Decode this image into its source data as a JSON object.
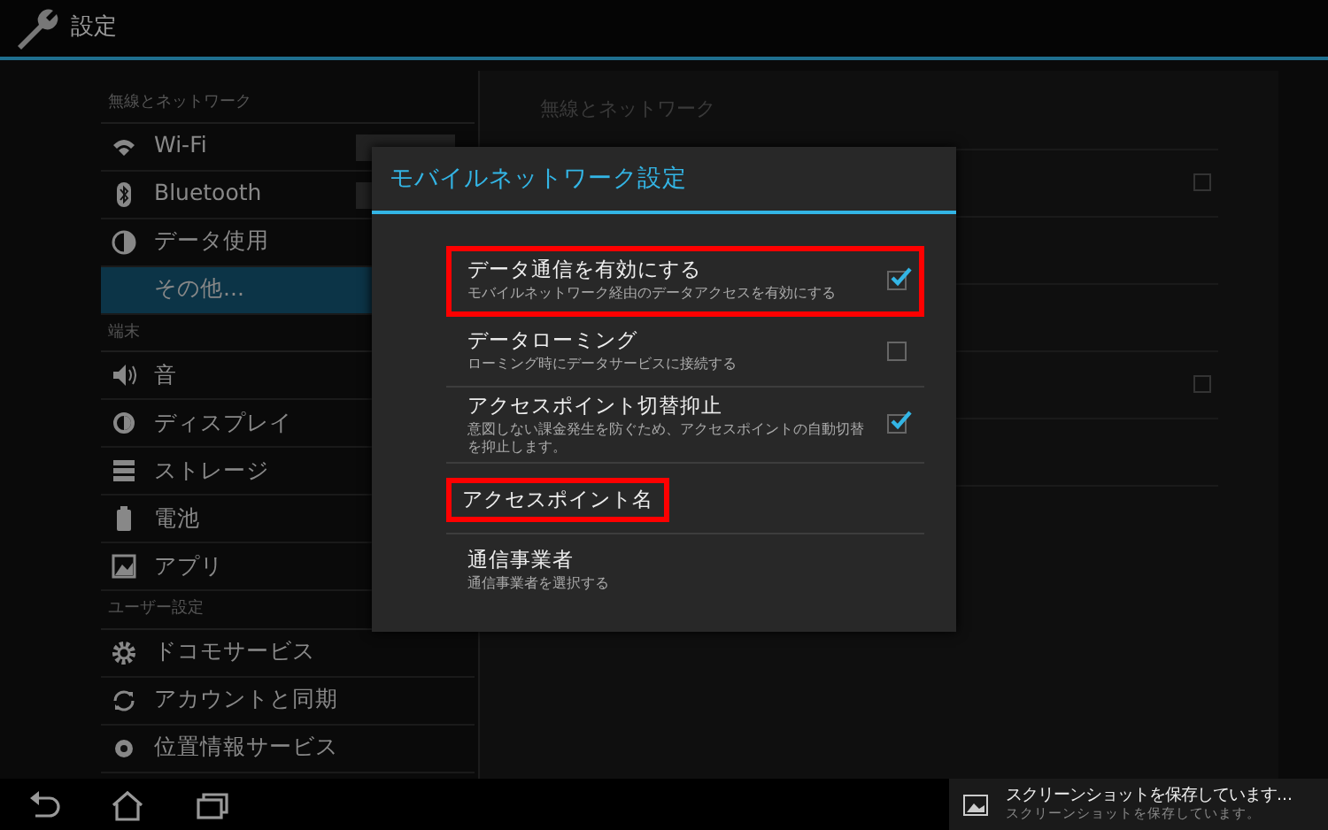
{
  "action_bar": {
    "title": "設定"
  },
  "sidebar": {
    "sections": [
      {
        "header": "無線とネットワーク",
        "items": [
          {
            "label": "Wi-Fi",
            "selected": false,
            "toggle": true
          },
          {
            "label": "Bluetooth",
            "selected": false,
            "toggle": true
          },
          {
            "label": "データ使用",
            "selected": false,
            "toggle": false
          },
          {
            "label": "その他...",
            "selected": true,
            "toggle": false
          }
        ]
      },
      {
        "header": "端末",
        "items": [
          {
            "label": "音",
            "selected": false,
            "toggle": false
          },
          {
            "label": "ディスプレイ",
            "selected": false,
            "toggle": false
          },
          {
            "label": "ストレージ",
            "selected": false,
            "toggle": false
          },
          {
            "label": "電池",
            "selected": false,
            "toggle": false
          },
          {
            "label": "アプリ",
            "selected": false,
            "toggle": false
          }
        ]
      },
      {
        "header": "ユーザー設定",
        "items": [
          {
            "label": "ドコモサービス",
            "selected": false,
            "toggle": false
          },
          {
            "label": "アカウントと同期",
            "selected": false,
            "toggle": false
          },
          {
            "label": "位置情報サービス",
            "selected": false,
            "toggle": false
          }
        ]
      }
    ]
  },
  "detail_pane": {
    "header": "無線とネットワーク",
    "rows": [
      {
        "kind": "checkbox",
        "checked": false
      },
      {
        "kind": "blank"
      },
      {
        "kind": "blank"
      },
      {
        "kind": "checkbox",
        "checked": false
      },
      {
        "kind": "blank"
      }
    ]
  },
  "dialog": {
    "title": "モバイルネットワーク設定",
    "items": [
      {
        "kind": "checkbox",
        "title": "データ通信を有効にする",
        "summary": "モバイルネットワーク経由のデータアクセスを有効にする",
        "checked": true,
        "highlighted": true
      },
      {
        "kind": "checkbox",
        "title": "データローミング",
        "summary": "ローミング時にデータサービスに接続する",
        "checked": false,
        "highlighted": false
      },
      {
        "kind": "checkbox",
        "title": "アクセスポイント切替抑止",
        "summary": "意図しない課金発生を防ぐため、アクセスポイントの自動切替を抑止します。",
        "checked": true,
        "highlighted": false
      },
      {
        "kind": "link",
        "title": "アクセスポイント名",
        "highlighted": true
      },
      {
        "kind": "link",
        "title": "通信事業者",
        "summary": "通信事業者を選択する",
        "highlighted": false
      }
    ]
  },
  "notification": {
    "title": "スクリーンショットを保存しています...",
    "text": "スクリーンショットを保存しています。"
  }
}
